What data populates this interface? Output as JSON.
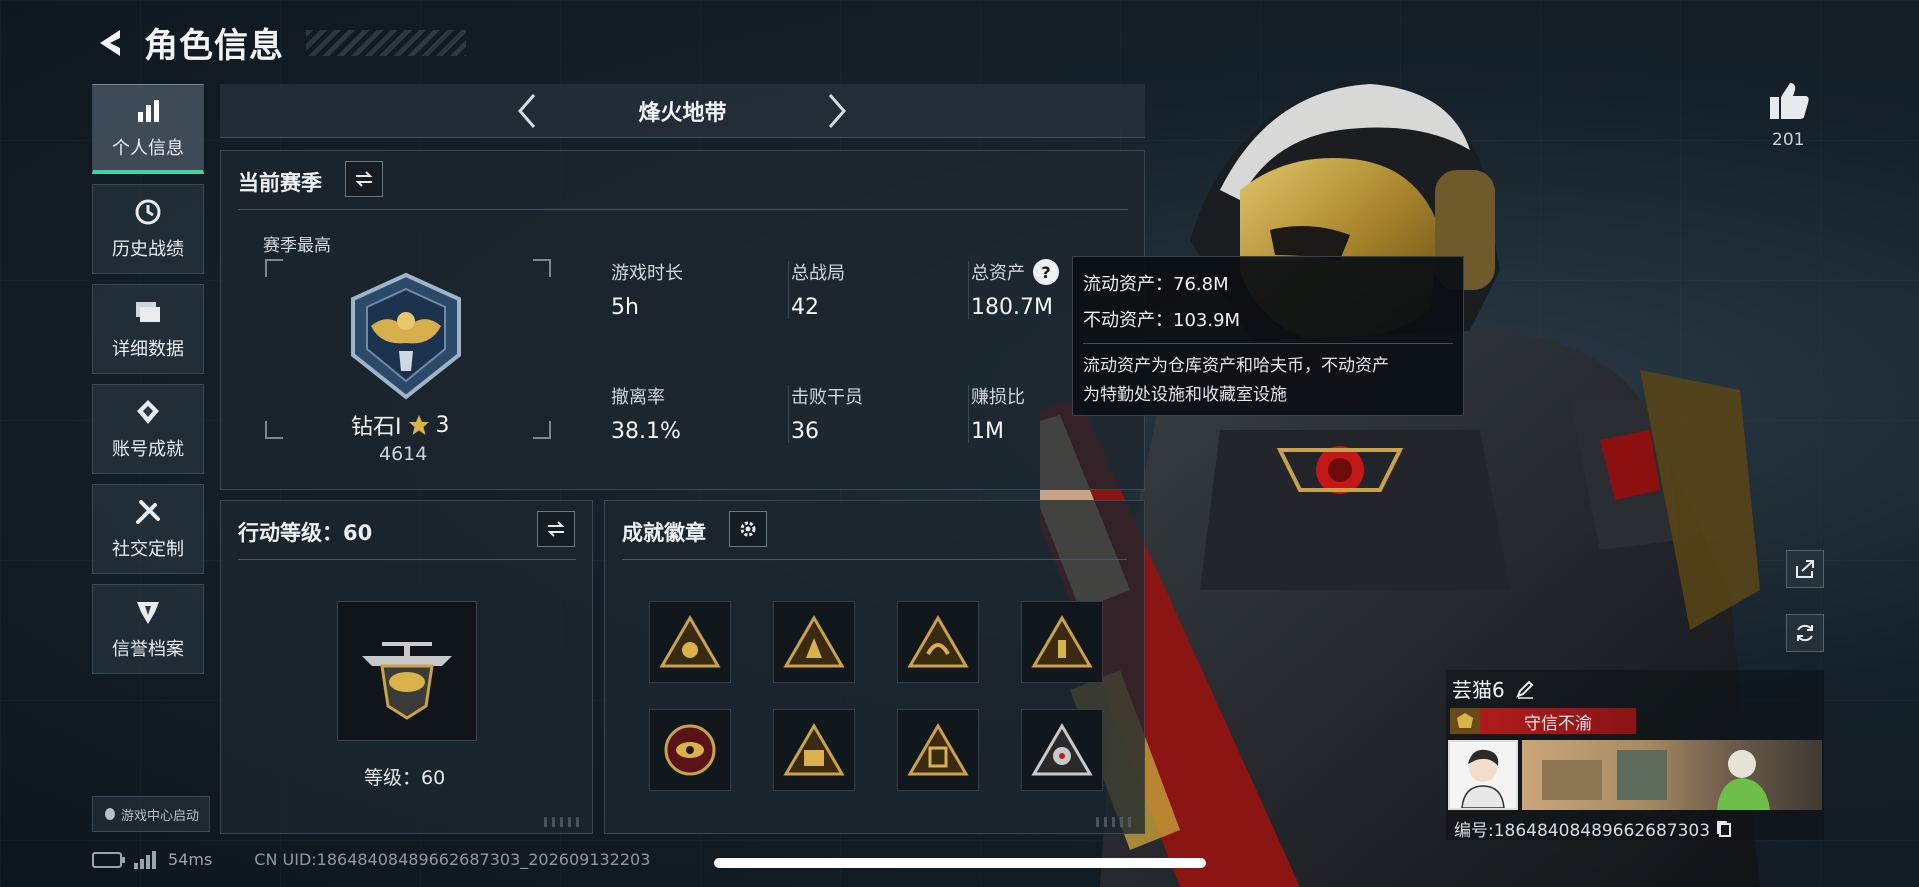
{
  "header": {
    "title": "角色信息"
  },
  "nav": {
    "items": [
      {
        "label": "个人信息",
        "icon": "bar-chart-icon",
        "active": true
      },
      {
        "label": "历史战绩",
        "icon": "clock-icon",
        "active": false
      },
      {
        "label": "详细数据",
        "icon": "folder-icon",
        "active": false
      },
      {
        "label": "账号成就",
        "icon": "medal-icon",
        "active": false
      },
      {
        "label": "社交定制",
        "icon": "tools-icon",
        "active": false
      },
      {
        "label": "信誉档案",
        "icon": "shield-icon",
        "active": false
      }
    ],
    "game_center": "游戏中心启动"
  },
  "map": {
    "name": "烽火地带"
  },
  "season": {
    "title": "当前赛季",
    "best_label": "赛季最高",
    "rank_name": "钻石I",
    "rank_stars": "3",
    "rank_score": "4614",
    "stats": [
      {
        "label": "游戏时长",
        "value": "5h"
      },
      {
        "label": "总战局",
        "value": "42"
      },
      {
        "label": "总资产",
        "value": "180.7M"
      },
      {
        "label": "撤离率",
        "value": "38.1%"
      },
      {
        "label": "击败干员",
        "value": "36"
      },
      {
        "label": "赚损比",
        "value": "1M"
      }
    ]
  },
  "tooltip": {
    "liquid": "流动资产：76.8M",
    "fixed": "不动资产：103.9M",
    "desc_line1": "流动资产为仓库资产和哈夫币，不动资产",
    "desc_line2": "为特勤处设施和收藏室设施"
  },
  "level": {
    "title": "行动等级：60",
    "level_text": "等级：60"
  },
  "achievements": {
    "title": "成就徽章",
    "badges": [
      "badge-1",
      "badge-2",
      "badge-3",
      "badge-4",
      "badge-5",
      "badge-6",
      "badge-7",
      "badge-8"
    ]
  },
  "social": {
    "likes": "201"
  },
  "player": {
    "name": "芸猫6",
    "tag": "守信不渝",
    "id": "编号:18648408489662687303"
  },
  "status": {
    "ping": "54ms",
    "uid": "CN UID:18648408489662687303_202609132203"
  },
  "colors": {
    "accent": "#43d1a1",
    "tag_red": "#b51e1e",
    "gold": "#c9a24a"
  }
}
